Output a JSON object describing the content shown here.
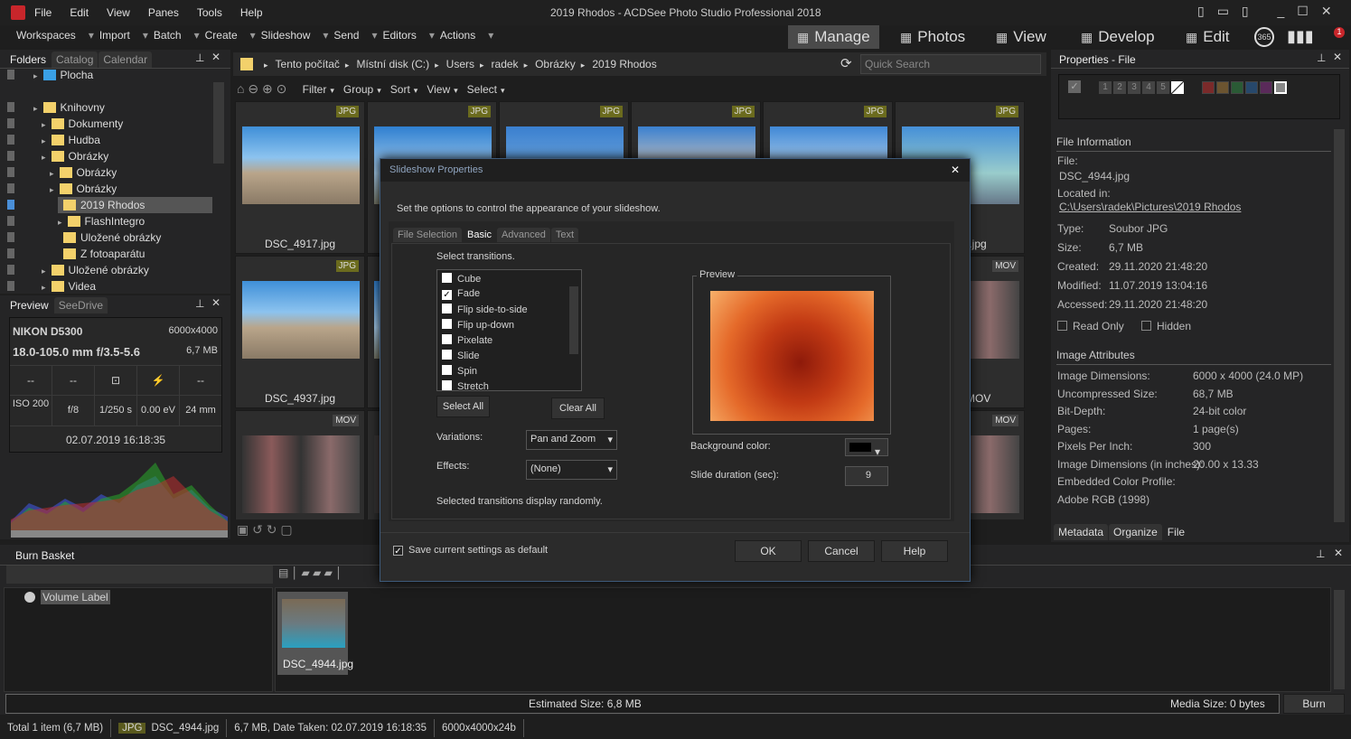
{
  "app": {
    "title": "2019 Rhodos - ACDSee Photo Studio Professional 2018",
    "menu": [
      "File",
      "Edit",
      "View",
      "Panes",
      "Tools",
      "Help"
    ]
  },
  "toolbar": {
    "items": [
      "Workspaces",
      "Import",
      "Batch",
      "Create",
      "Slideshow",
      "Send",
      "Editors",
      "Actions"
    ],
    "modes": [
      "Manage",
      "Photos",
      "View",
      "Develop",
      "Edit"
    ],
    "badge_365": "365",
    "notif_count": "1"
  },
  "left": {
    "tabs": [
      "Folders",
      "Catalog",
      "Calendar"
    ],
    "tree": [
      {
        "label": "Plocha",
        "lvl": 1
      },
      {
        "label": "Knihovny",
        "lvl": 1
      },
      {
        "label": "Dokumenty",
        "lvl": 2
      },
      {
        "label": "Hudba",
        "lvl": 2
      },
      {
        "label": "Obrázky",
        "lvl": 2
      },
      {
        "label": "Obrázky",
        "lvl": 3
      },
      {
        "label": "Obrázky",
        "lvl": 3
      },
      {
        "label": "2019 Rhodos",
        "lvl": 4,
        "selected": true
      },
      {
        "label": "FlashIntegro",
        "lvl": 4
      },
      {
        "label": "Uložené obrázky",
        "lvl": 4
      },
      {
        "label": "Z fotoaparátu",
        "lvl": 4
      },
      {
        "label": "Uložené obrázky",
        "lvl": 2
      },
      {
        "label": "Videa",
        "lvl": 2
      }
    ],
    "preview_tabs": [
      "Preview",
      "SeeDrive"
    ],
    "exif": {
      "camera": "NIKON D5300",
      "lens": "18.0-105.0 mm f/3.5-5.6",
      "dims": "6000x4000",
      "size": "6,7 MB",
      "row1": [
        "--",
        "--",
        "",
        "",
        "--"
      ],
      "iso": "ISO 200",
      "aperture": "f/8",
      "shutter": "1/250 s",
      "ev": "0.00 eV",
      "focal": "24 mm",
      "date": "02.07.2019 16:18:35"
    }
  },
  "center": {
    "breadcrumb": [
      "Tento počítač",
      "Místní disk (C:)",
      "Users",
      "radek",
      "Obrázky",
      "2019 Rhodos"
    ],
    "search_placeholder": "Quick Search",
    "nav": [
      "Filter",
      "Group",
      "Sort",
      "View",
      "Select"
    ],
    "thumbs": [
      {
        "badge": "JPG",
        "label": "DSC_4917.jpg"
      },
      {
        "badge": "JPG",
        "label": ""
      },
      {
        "badge": "JPG",
        "label": ""
      },
      {
        "badge": "JPG",
        "label": ""
      },
      {
        "badge": "JPG",
        "label": ""
      },
      {
        "badge": "JPG",
        "label": "..jpg"
      },
      {
        "badge": "JPG",
        "label": "DSC_4937.jpg"
      },
      {
        "badge": "",
        "label": ""
      },
      {
        "badge": "",
        "label": ""
      },
      {
        "badge": "",
        "label": ""
      },
      {
        "badge": "",
        "label": ""
      },
      {
        "badge": "MOV",
        "label": "MOV"
      },
      {
        "badge": "MOV",
        "label": ""
      },
      {
        "badge": "",
        "label": ""
      },
      {
        "badge": "",
        "label": ""
      },
      {
        "badge": "",
        "label": ""
      },
      {
        "badge": "",
        "label": ""
      },
      {
        "badge": "MOV",
        "label": ""
      }
    ]
  },
  "dialog": {
    "title": "Slideshow Properties",
    "intro": "Set the options to control the appearance of your slideshow.",
    "tabs": [
      "File Selection",
      "Basic",
      "Advanced",
      "Text"
    ],
    "active_tab": "Basic",
    "select_label": "Select transitions.",
    "transitions": [
      {
        "label": "Cube",
        "checked": false
      },
      {
        "label": "Fade",
        "checked": true
      },
      {
        "label": "Flip side-to-side",
        "checked": false
      },
      {
        "label": "Flip up-down",
        "checked": false
      },
      {
        "label": "Pixelate",
        "checked": false
      },
      {
        "label": "Slide",
        "checked": false
      },
      {
        "label": "Spin",
        "checked": false
      },
      {
        "label": "Stretch",
        "checked": false
      }
    ],
    "select_all": "Select All",
    "clear_all": "Clear All",
    "variations_label": "Variations:",
    "variations_value": "Pan and Zoom",
    "effects_label": "Effects:",
    "effects_value": "(None)",
    "random_note": "Selected transitions display randomly.",
    "preview_label": "Preview",
    "bg_label": "Background color:",
    "bg_color": "#000000",
    "duration_label": "Slide duration (sec):",
    "duration_value": "9",
    "save_default": "Save current settings as default",
    "save_checked": true,
    "ok": "OK",
    "cancel": "Cancel",
    "help": "Help"
  },
  "right": {
    "title": "Properties - File",
    "ratings": [
      "1",
      "2",
      "3",
      "4",
      "5"
    ],
    "labels_colors": [
      "#7a2a2a",
      "#6b5430",
      "#2a5a35",
      "#27486b",
      "#5a2a5a",
      "#888888"
    ],
    "file_info": "File Information",
    "file_label": "File:",
    "file_value": "DSC_4944.jpg",
    "located_label": "Located in:",
    "located_value": "C:\\Users\\radek\\Pictures\\2019 Rhodos",
    "props": [
      {
        "k": "Type:",
        "v": "Soubor JPG"
      },
      {
        "k": "Size:",
        "v": "6,7 MB"
      },
      {
        "k": "Created:",
        "v": "29.11.2020 21:48:20"
      },
      {
        "k": "Modified:",
        "v": "11.07.2019 13:04:16"
      },
      {
        "k": "Accessed:",
        "v": "29.11.2020 21:48:20"
      }
    ],
    "readonly": "Read Only",
    "hidden": "Hidden",
    "image_attr": "Image Attributes",
    "attrs": [
      {
        "k": "Image Dimensions:",
        "v": "6000 x 4000 (24.0 MP)"
      },
      {
        "k": "Uncompressed Size:",
        "v": "68,7 MB"
      },
      {
        "k": "Bit-Depth:",
        "v": "24-bit color"
      },
      {
        "k": "Pages:",
        "v": "1 page(s)"
      },
      {
        "k": "Pixels Per Inch:",
        "v": "300"
      },
      {
        "k": "Image Dimensions (in inches):",
        "v": "20.00 x 13.33"
      },
      {
        "k": "Embedded Color Profile:",
        "v": ""
      },
      {
        "k": "Adobe RGB (1998)",
        "v": ""
      }
    ],
    "bottom_tabs": [
      "Metadata",
      "Organize",
      "File"
    ]
  },
  "burn": {
    "title": "Burn Basket",
    "volume": "Volume Label",
    "file": "DSC_4944.jpg",
    "estimated": "Estimated Size: 6,8 MB",
    "media": "Media Size: 0 bytes",
    "burn": "Burn"
  },
  "status": {
    "total": "Total 1 item  (6,7 MB)",
    "type": "JPG",
    "file": "DSC_4944.jpg",
    "info": "6,7 MB, Date Taken: 02.07.2019 16:18:35",
    "dims": "6000x4000x24b"
  }
}
